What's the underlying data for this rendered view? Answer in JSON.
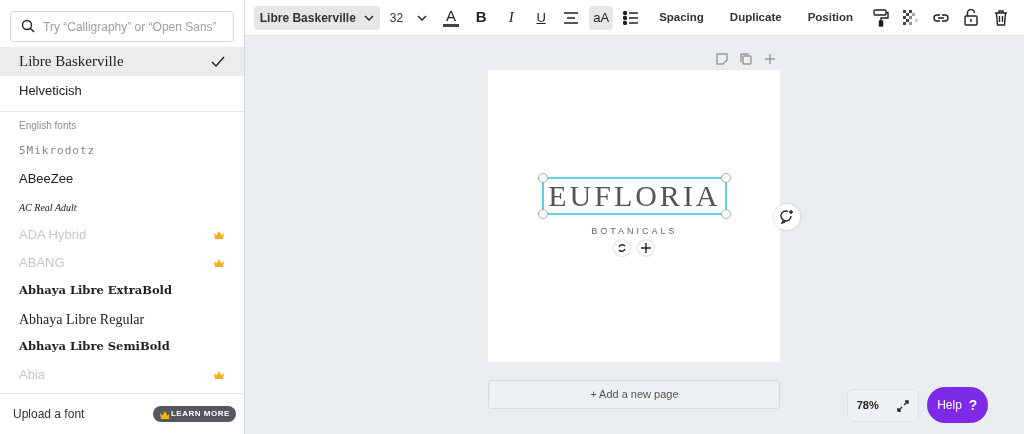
{
  "font_panel": {
    "search": {
      "placeholder": "Try “Calligraphy” or “Open Sans”"
    },
    "recent": [
      {
        "label": "Libre Baskerville",
        "kind": "serif",
        "selected": true
      },
      {
        "label": "Helveticish",
        "kind": "sans",
        "selected": false
      }
    ],
    "section_title": "English fonts",
    "fonts": [
      {
        "label": "5Mikrodotz",
        "kind": "dotted",
        "premium": false
      },
      {
        "label": "ABeeZee",
        "kind": "sans",
        "premium": false
      },
      {
        "label": "AC Real Adult",
        "kind": "script",
        "premium": false
      },
      {
        "label": "ADA Hybrid",
        "kind": "sans",
        "premium": true
      },
      {
        "label": "ABANG",
        "kind": "sans",
        "premium": true
      },
      {
        "label": "Abhaya Libre ExtraBold",
        "kind": "serif-bold",
        "premium": false
      },
      {
        "label": "Abhaya Libre Regular",
        "kind": "serif",
        "premium": false
      },
      {
        "label": "Abhaya Libre SemiBold",
        "kind": "serif-bold",
        "premium": false
      },
      {
        "label": "Abia",
        "kind": "sans",
        "premium": true
      }
    ],
    "upload": "Upload a font",
    "learn_more": "LEARN MORE"
  },
  "toolbar": {
    "font": "Libre Baskerville",
    "size": "32",
    "items": [
      {
        "kind": "color",
        "label": "A",
        "active": false
      },
      {
        "kind": "bold",
        "label": "B",
        "active": false
      },
      {
        "kind": "italic",
        "label": "I",
        "active": false
      },
      {
        "kind": "underline",
        "label": "U",
        "active": false
      },
      {
        "kind": "align",
        "active": false
      },
      {
        "kind": "case",
        "label": "aA",
        "active": true
      },
      {
        "kind": "list",
        "active": false
      },
      {
        "kind": "text",
        "label": "Spacing",
        "active": false
      },
      {
        "kind": "text",
        "label": "Duplicate",
        "active": false
      },
      {
        "kind": "text",
        "label": "Position",
        "active": false
      },
      {
        "kind": "roller",
        "active": false
      },
      {
        "kind": "transparency",
        "active": false
      },
      {
        "kind": "link",
        "active": false
      },
      {
        "kind": "lock",
        "active": false
      },
      {
        "kind": "trash",
        "active": false
      }
    ]
  },
  "canvas": {
    "title": "EUFLORIA",
    "subtitle": "BOTANICALS",
    "title_selected": true,
    "add_page": "+ Add a new page",
    "zoom": "78%",
    "help": "Help",
    "help_mark": "?"
  }
}
